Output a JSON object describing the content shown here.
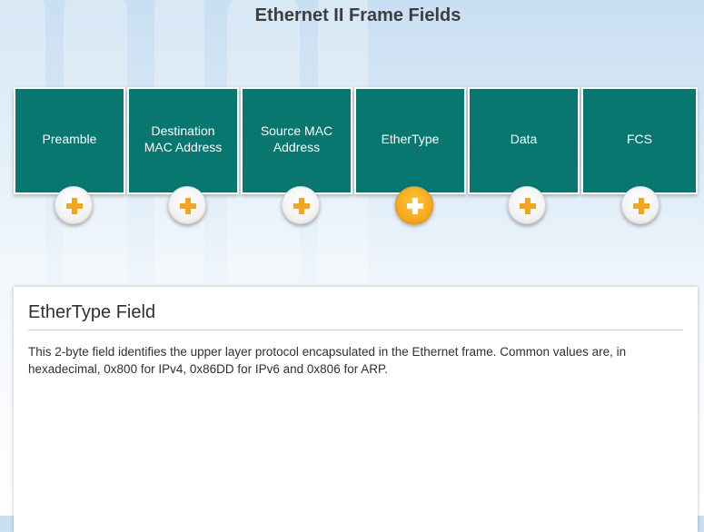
{
  "page_title": "Ethernet II Frame Fields",
  "fields": [
    {
      "label": "Preamble",
      "active": false
    },
    {
      "label": "Destination\nMAC Address",
      "active": false
    },
    {
      "label": "Source  MAC\nAddress",
      "active": false
    },
    {
      "label": "EtherType",
      "active": true
    },
    {
      "label": "Data",
      "active": false
    },
    {
      "label": "FCS",
      "active": false
    }
  ],
  "colors": {
    "field_fill": "#08776f",
    "active_button": "#f4a61a",
    "inactive_plus": "#f2a51d",
    "active_plus": "#ffffff"
  },
  "icons": {
    "expand": "plus-icon"
  },
  "info": {
    "title": "EtherType Field",
    "body": "This 2-byte field identifies the upper layer protocol encapsulated in the Ethernet frame. Common values are, in hexadecimal, 0x800 for IPv4, 0x86DD for IPv6 and 0x806 for ARP."
  }
}
